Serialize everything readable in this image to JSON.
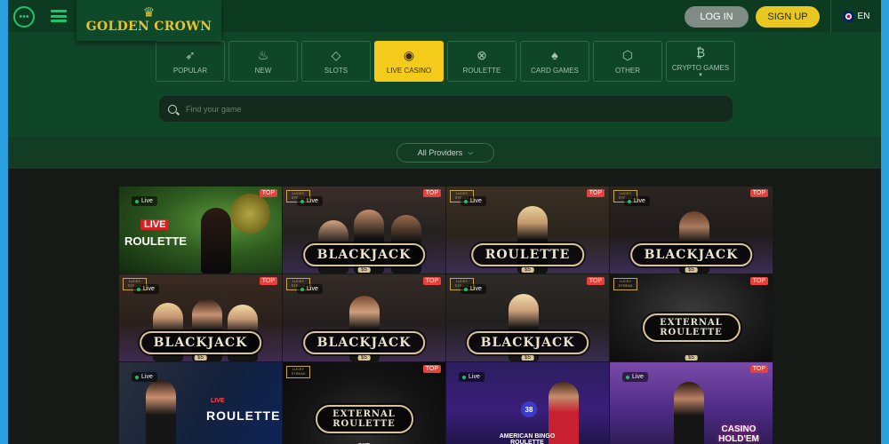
{
  "brand": {
    "name": "GOLDEN CROWN",
    "crown_icon": "crown-icon",
    "color": "#e8c232"
  },
  "header": {
    "chat_icon": "chat-bubble-icon",
    "menu_icon": "hamburger-menu-icon",
    "login_label": "LOG IN",
    "signup_label": "SIGN UP",
    "language": "EN",
    "flag_icon": "uk-flag-icon"
  },
  "categories": [
    {
      "label": "POPULAR",
      "icon": "rocket-icon",
      "active": false
    },
    {
      "label": "NEW",
      "icon": "flame-icon",
      "active": false
    },
    {
      "label": "SLOTS",
      "icon": "diamond-icon",
      "active": false
    },
    {
      "label": "LIVE CASINO",
      "icon": "lips-icon",
      "active": true
    },
    {
      "label": "ROULETTE",
      "icon": "roulette-wheel-icon",
      "active": false
    },
    {
      "label": "CARD GAMES",
      "icon": "spade-icon",
      "active": false
    },
    {
      "label": "OTHER",
      "icon": "cube-icon",
      "active": false
    },
    {
      "label": "CRYPTO GAMES",
      "icon": "bitcoin-icon",
      "active": false
    }
  ],
  "search": {
    "placeholder": "Find your game",
    "icon": "search-icon"
  },
  "providers": {
    "label": "All Providers",
    "icon": "chevron-down-icon"
  },
  "tiles": [
    {
      "title": "LIVE ROULETTE",
      "live": "Live",
      "top": "TOP"
    },
    {
      "title": "BLACKJACK",
      "live": "Live",
      "top": "TOP",
      "lucky": "LUCKY STREAK",
      "chip": "$5"
    },
    {
      "title": "ROULETTE",
      "live": "Live",
      "top": "TOP",
      "lucky": "LUCKY STREAK",
      "chip": "$5"
    },
    {
      "title": "BLACKJACK",
      "live": "Live",
      "top": "TOP",
      "lucky": "LUCKY STREAK",
      "chip": "$5"
    },
    {
      "title": "BLACKJACK",
      "live": "Live",
      "top": "TOP",
      "lucky": "LUCKY STREAK",
      "chip": "$5"
    },
    {
      "title": "BLACKJACK",
      "live": "Live",
      "top": "TOP",
      "lucky": "LUCKY STREAK",
      "chip": "$5"
    },
    {
      "title": "BLACKJACK",
      "live": "Live",
      "top": "TOP",
      "lucky": "LUCKY STREAK",
      "chip": "$5"
    },
    {
      "title": "EXTERNAL ROULETTE",
      "top": "TOP",
      "lucky": "LUCKY STREAK",
      "chip": "$5"
    },
    {
      "title": "LIVE ROULETTE",
      "live": "Live"
    },
    {
      "title": "EXTERNAL ROULETTE",
      "top": "TOP",
      "lucky": "LUCKY STREAK",
      "chip": "$5"
    },
    {
      "title": "AMERICAN BINGO ROULETTE",
      "live": "Live",
      "ball": "38"
    },
    {
      "title": "CASINO HOLD'EM",
      "live": "Live",
      "top": "TOP"
    }
  ]
}
